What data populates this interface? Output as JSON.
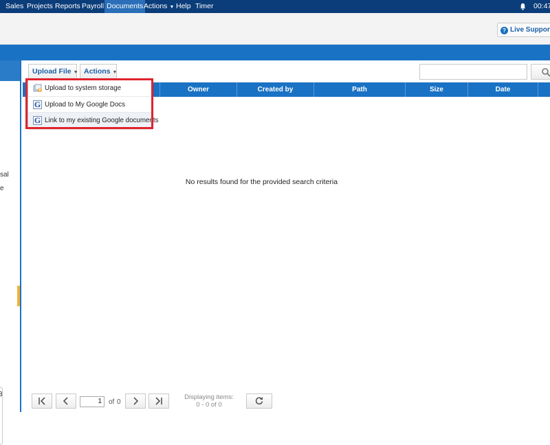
{
  "topnav": {
    "items": [
      "Sales",
      "Projects",
      "Reports",
      "Payroll",
      "Documents",
      "Actions",
      "Help",
      "Timer"
    ],
    "active": "Documents",
    "clock": "00:47"
  },
  "header": {
    "live_support_label": "Live Support"
  },
  "sidebar": {
    "fragments": [
      ":",
      "sal",
      "e",
      "3"
    ]
  },
  "toolbar": {
    "upload_label": "Upload File",
    "actions_label": "Actions",
    "search_placeholder": ""
  },
  "table": {
    "columns": [
      "",
      "Owner",
      "Created by",
      "Path",
      "Size",
      "Date"
    ],
    "empty_message": "No results found for the provided search criteria"
  },
  "upload_menu": {
    "items": [
      {
        "label": "Upload to system storage",
        "icon": "storage-upload-icon"
      },
      {
        "label": "Upload to My Google Docs",
        "icon": "google-docs-icon"
      },
      {
        "label": "Link to my existing Google documents",
        "icon": "google-docs-icon"
      }
    ],
    "highlight_color": "#e0232e"
  },
  "pager": {
    "current_page": "1",
    "of_label": "of",
    "total_pages": "0",
    "displaying_label": "Displaying items:",
    "displaying_range": "0 - 0 of 0"
  },
  "colors": {
    "topnav": "#0b3d7a",
    "accent_blue": "#1a72c4",
    "link_blue": "#1a5fa8"
  }
}
